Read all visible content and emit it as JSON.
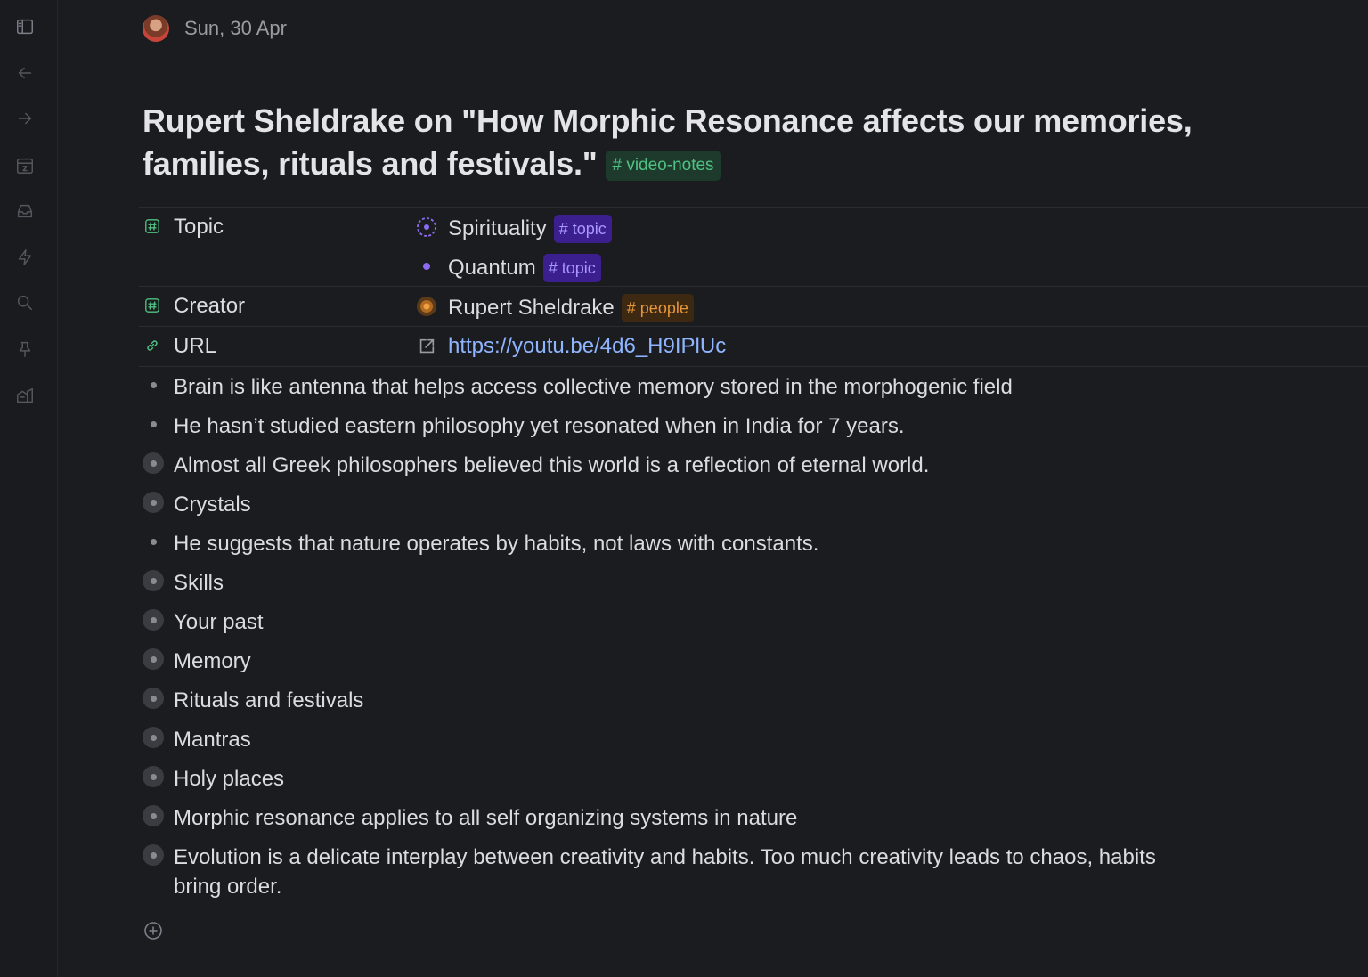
{
  "header": {
    "date": "Sun, 30 Apr"
  },
  "title": {
    "text": "Rupert Sheldrake on \"How Morphic Resonance affects our memories, families, rituals and festivals.\"",
    "tag": "# video-notes"
  },
  "fields": {
    "topic": {
      "label": "Topic",
      "values": [
        {
          "text": "Spirituality",
          "tag": "# topic"
        },
        {
          "text": "Quantum",
          "tag": "# topic"
        }
      ]
    },
    "creator": {
      "label": "Creator",
      "value": "Rupert Sheldrake",
      "tag": "# people"
    },
    "url": {
      "label": "URL",
      "value": "https://youtu.be/4d6_H9IPlUc"
    }
  },
  "bullets": [
    {
      "text": "Brain is like antenna that helps access collective memory stored in the morphogenic field",
      "style": "small"
    },
    {
      "text": "He hasn’t studied eastern philosophy yet resonated when in India for 7 years.",
      "style": "small"
    },
    {
      "text": "Almost all Greek philosophers believed this world is a reflection of eternal world.",
      "style": "big"
    },
    {
      "text": "Crystals",
      "style": "big"
    },
    {
      "text": "He suggests that nature operates by habits, not laws with constants.",
      "style": "small"
    },
    {
      "text": "Skills",
      "style": "big"
    },
    {
      "text": "Your past",
      "style": "big"
    },
    {
      "text": "Memory",
      "style": "big"
    },
    {
      "text": "Rituals and festivals",
      "style": "big"
    },
    {
      "text": "Mantras",
      "style": "big"
    },
    {
      "text": "Holy places",
      "style": "big"
    },
    {
      "text": "Morphic resonance applies to all self organizing systems in nature",
      "style": "big"
    },
    {
      "text": "Evolution is a delicate interplay between creativity and habits. Too much creativity leads to chaos, habits bring order.",
      "style": "big"
    }
  ],
  "sidebar": {
    "icons": [
      "sidebar-toggle-icon",
      "back-arrow-icon",
      "forward-arrow-icon",
      "calendar-icon",
      "inbox-icon",
      "lightning-icon",
      "search-icon",
      "pin-icon",
      "library-icon"
    ]
  },
  "colors": {
    "background": "#1b1c20",
    "tag_green": "#4fc283",
    "tag_purple": "#a996ff",
    "tag_orange": "#e5953a",
    "link": "#8fb5ff"
  }
}
